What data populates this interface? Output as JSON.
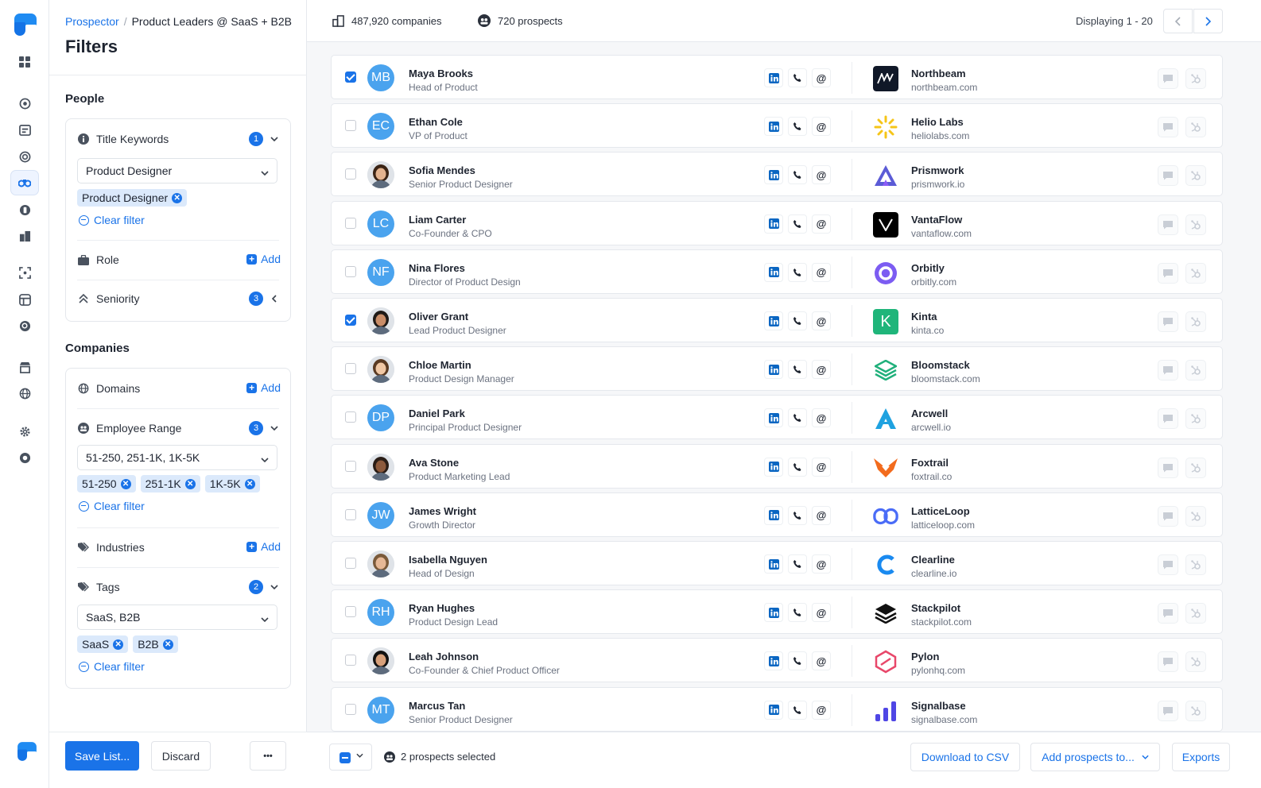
{
  "breadcrumb": {
    "root": "Prospector",
    "current": "Product Leaders @ SaaS + B2B"
  },
  "page_title": "Filters",
  "sections": {
    "people": "People",
    "companies": "Companies"
  },
  "filters": {
    "title_keywords": {
      "label": "Title Keywords",
      "count": "1",
      "selected": "Product Designer",
      "chips": [
        "Product Designer"
      ],
      "clear": "Clear filter"
    },
    "role": {
      "label": "Role",
      "add": "Add"
    },
    "seniority": {
      "label": "Seniority",
      "count": "3"
    },
    "domains": {
      "label": "Domains",
      "add": "Add"
    },
    "employee_range": {
      "label": "Employee Range",
      "count": "3",
      "selected": "51-250, 251-1K, 1K-5K",
      "chips": [
        "51-250",
        "251-1K",
        "1K-5K"
      ],
      "clear": "Clear filter"
    },
    "industries": {
      "label": "Industries",
      "add": "Add"
    },
    "tags": {
      "label": "Tags",
      "count": "2",
      "selected": "SaaS, B2B",
      "chips": [
        "SaaS",
        "B2B"
      ],
      "clear": "Clear filter"
    }
  },
  "footer": {
    "save": "Save List...",
    "discard": "Discard",
    "more": "•••"
  },
  "topbar": {
    "companies": "487,920 companies",
    "prospects": "720 prospects",
    "displaying": "Displaying 1 - 20"
  },
  "prospects": [
    {
      "name": "Maya Brooks",
      "title": "Head of Product",
      "initials": "MB",
      "photo": false,
      "checked": true,
      "company": "Northbeam",
      "domain": "northbeam.com",
      "logo": "northbeam-logo"
    },
    {
      "name": "Ethan Cole",
      "title": "VP of Product",
      "initials": "EC",
      "photo": false,
      "checked": false,
      "company": "Helio Labs",
      "domain": "heliolabs.com",
      "logo": "heliolabs-logo"
    },
    {
      "name": "Sofia Mendes",
      "title": "Senior Product Designer",
      "initials": "",
      "photo": true,
      "checked": false,
      "company": "Prismwork",
      "domain": "prismwork.io",
      "logo": "prismwork-logo"
    },
    {
      "name": "Liam Carter",
      "title": "Co-Founder & CPO",
      "initials": "LC",
      "photo": false,
      "checked": false,
      "company": "VantaFlow",
      "domain": "vantaflow.com",
      "logo": "vantaflow-logo"
    },
    {
      "name": "Nina Flores",
      "title": "Director of Product Design",
      "initials": "NF",
      "photo": false,
      "checked": false,
      "company": "Orbitly",
      "domain": "orbitly.com",
      "logo": "orbitly-logo"
    },
    {
      "name": "Oliver Grant",
      "title": "Lead Product Designer",
      "initials": "",
      "photo": true,
      "checked": true,
      "company": "Kinta",
      "domain": "kinta.co",
      "logo": "kinta-logo"
    },
    {
      "name": "Chloe Martin",
      "title": "Product Design Manager",
      "initials": "",
      "photo": true,
      "checked": false,
      "company": "Bloomstack",
      "domain": "bloomstack.com",
      "logo": "bloomstack-logo"
    },
    {
      "name": "Daniel Park",
      "title": "Principal Product Designer",
      "initials": "DP",
      "photo": false,
      "checked": false,
      "company": "Arcwell",
      "domain": "arcwell.io",
      "logo": "arcwell-logo"
    },
    {
      "name": "Ava Stone",
      "title": "Product Marketing Lead",
      "initials": "",
      "photo": true,
      "checked": false,
      "company": "Foxtrail",
      "domain": "foxtrail.co",
      "logo": "foxtrail-logo"
    },
    {
      "name": "James Wright",
      "title": "Growth Director",
      "initials": "JW",
      "photo": false,
      "checked": false,
      "company": "LatticeLoop",
      "domain": "latticeloop.com",
      "logo": "latticeloop-logo"
    },
    {
      "name": "Isabella Nguyen",
      "title": "Head of Design",
      "initials": "",
      "photo": true,
      "checked": false,
      "company": "Clearline",
      "domain": "clearline.io",
      "logo": "clearline-logo"
    },
    {
      "name": "Ryan Hughes",
      "title": "Product Design Lead",
      "initials": "RH",
      "photo": false,
      "checked": false,
      "company": "Stackpilot",
      "domain": "stackpilot.com",
      "logo": "stackpilot-logo"
    },
    {
      "name": "Leah Johnson",
      "title": "Co-Founder & Chief Product Officer",
      "initials": "",
      "photo": true,
      "checked": false,
      "company": "Pylon",
      "domain": "pylonhq.com",
      "logo": "pylon-logo"
    },
    {
      "name": "Marcus Tan",
      "title": "Senior Product Designer",
      "initials": "MT",
      "photo": false,
      "checked": false,
      "company": "Signalbase",
      "domain": "signalbase.com",
      "logo": "signalbase-logo"
    }
  ],
  "bottombar": {
    "selected": "2 prospects selected",
    "download": "Download to CSV",
    "add_to": "Add prospects to...",
    "exports": "Exports"
  },
  "colors": {
    "accent": "#1a73e8",
    "avatar": "#4aa3ee"
  }
}
